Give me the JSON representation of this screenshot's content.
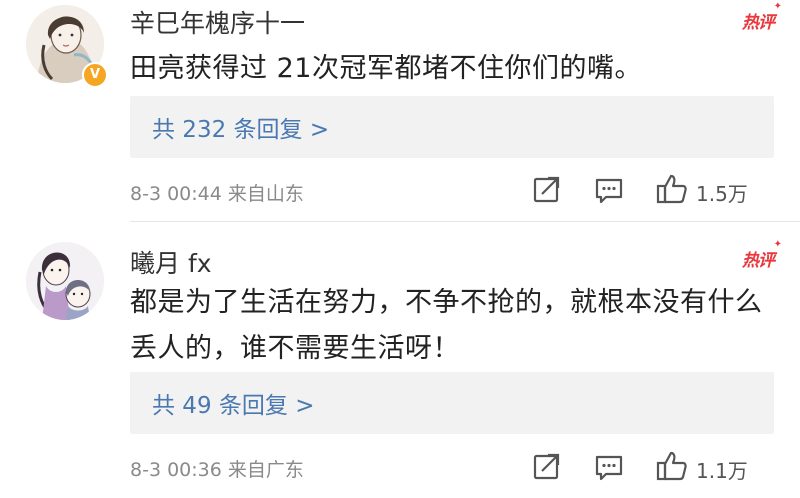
{
  "comments": [
    {
      "username": "辛巳年槐序十一",
      "verified_badge": "V",
      "hot_label": "热评",
      "text": "田亮获得过 21次冠军都堵不住你们的嘴。",
      "replies_label": "共 232 条回复 >",
      "meta": "8-3 00:44  来自山东",
      "likes": "1.5万",
      "icons": [
        "share-icon",
        "comment-icon",
        "like-icon"
      ]
    },
    {
      "username": "曦月 fx",
      "hot_label": "热评",
      "text": "都是为了生活在努力，不争不抢的，就根本没有什么丢人的，谁不需要生活呀！",
      "replies_label": "共 49 条回复 >",
      "meta": "8-3 00:36  来自广东",
      "likes": "1.1万",
      "icons": [
        "share-icon",
        "comment-icon",
        "like-icon"
      ]
    }
  ],
  "colors": {
    "hot": "#e8383d",
    "link": "#4a78b0",
    "reply_bg": "#f2f2f2",
    "meta": "#8a8a8a",
    "badge": "#f5a623"
  }
}
